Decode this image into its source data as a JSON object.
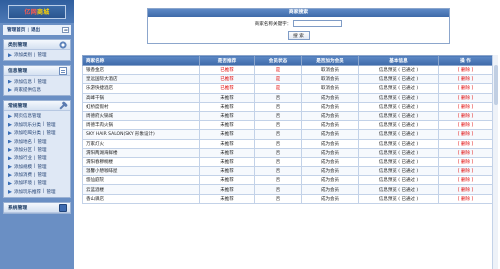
{
  "sidebar": {
    "logo_main": "亿网",
    "logo_accent": "商城",
    "top_links": {
      "home": "管理首页",
      "logout": "退出",
      "toggle": "◂◂"
    },
    "groups": [
      {
        "title": "类别管理",
        "icon": "gear-icon",
        "items": [
          {
            "primary": "添加类别",
            "secondary": "管理"
          }
        ]
      },
      {
        "title": "信息管理",
        "icon": "document-icon",
        "items": [
          {
            "primary": "添加信息",
            "secondary": "管理"
          },
          {
            "primary": "商家提供信息",
            "secondary": ""
          }
        ]
      },
      {
        "title": "常规管理",
        "icon": "wrench-icon",
        "items": [
          {
            "primary": "网页信息管理",
            "secondary": ""
          },
          {
            "primary": "添加玩乐分类",
            "secondary": "管理"
          },
          {
            "primary": "添加吃喝分类",
            "secondary": "管理"
          },
          {
            "primary": "添加地名",
            "secondary": "管理"
          },
          {
            "primary": "添加分区",
            "secondary": "管理"
          },
          {
            "primary": "添加行业",
            "secondary": "管理"
          },
          {
            "primary": "添加规模",
            "secondary": "管理"
          },
          {
            "primary": "添加消费",
            "secondary": "管理"
          },
          {
            "primary": "添加环境",
            "secondary": "管理"
          },
          {
            "primary": "添加玩乐推荐",
            "secondary": "管理"
          }
        ]
      },
      {
        "title": "系统管理",
        "icon": "monitor-icon",
        "items": []
      }
    ]
  },
  "search": {
    "header": "商家搜索",
    "label": "商家名称关键字：",
    "value": "",
    "button": "搜 索"
  },
  "table": {
    "columns": [
      "商家名称",
      "是否推荐",
      "会员状态",
      "是否加为会员",
      "基本信息",
      "操 作"
    ],
    "rows": [
      {
        "name": "银香金店",
        "recommend": "已推荐",
        "status": "是",
        "member": "取消会员",
        "info": "信息预览 ( 已通过 )",
        "op": "[ 删除 ]"
      },
      {
        "name": "皇远国际大酒店",
        "recommend": "已推荐",
        "status": "是",
        "member": "取消会员",
        "info": "信息预览 ( 已通过 )",
        "op": "[ 删除 ]"
      },
      {
        "name": "乐游快捷酒店",
        "recommend": "已推荐",
        "status": "是",
        "member": "取消会员",
        "info": "信息预览 ( 已通过 )",
        "op": "[ 删除 ]"
      },
      {
        "name": "高峰干锅",
        "recommend": "未推荐",
        "status": "否",
        "member": "成为会员",
        "info": "信息预览 ( 已通过 )",
        "op": "[ 删除 ]"
      },
      {
        "name": "虹桥度假村",
        "recommend": "未推荐",
        "status": "否",
        "member": "成为会员",
        "info": "信息预览 ( 已通过 )",
        "op": "[ 删除 ]"
      },
      {
        "name": "周德府火锅城",
        "recommend": "未推荐",
        "status": "否",
        "member": "成为会员",
        "info": "信息预览 ( 已通过 )",
        "op": "[ 删除 ]"
      },
      {
        "name": "周德丰肉火锅",
        "recommend": "未推荐",
        "status": "否",
        "member": "成为会员",
        "info": "信息预览 ( 已通过 )",
        "op": "[ 删除 ]"
      },
      {
        "name": "SKY HAIR SALON(SKY 形象设计)",
        "recommend": "未推荐",
        "status": "否",
        "member": "成为会员",
        "info": "信息预览 ( 已通过 )",
        "op": "[ 删除 ]"
      },
      {
        "name": "万家灯火",
        "recommend": "未推荐",
        "status": "否",
        "member": "成为会员",
        "info": "信息预览 ( 已通过 )",
        "op": "[ 删除 ]"
      },
      {
        "name": "渭阳两湖海鲜楼",
        "recommend": "未推荐",
        "status": "否",
        "member": "成为会员",
        "info": "信息预览 ( 已通过 )",
        "op": "[ 删除 ]"
      },
      {
        "name": "渭阳春穆桐楼",
        "recommend": "未推荐",
        "status": "否",
        "member": "成为会员",
        "info": "信息预览 ( 已通过 )",
        "op": "[ 删除 ]"
      },
      {
        "name": "温馨小憩咖啡屋",
        "recommend": "未推荐",
        "status": "否",
        "member": "成为会员",
        "info": "信息预览 ( 已通过 )",
        "op": "[ 删除 ]"
      },
      {
        "name": "悠仙庭院",
        "recommend": "未推荐",
        "status": "否",
        "member": "成为会员",
        "info": "信息预览 ( 已通过 )",
        "op": "[ 删除 ]"
      },
      {
        "name": "云蓝酒楼",
        "recommend": "未推荐",
        "status": "否",
        "member": "成为会员",
        "info": "信息预览 ( 已通过 )",
        "op": "[ 删除 ]"
      },
      {
        "name": "香山驿店",
        "recommend": "未推荐",
        "status": "否",
        "member": "成为会员",
        "info": "信息预览 ( 已通过 )",
        "op": "[ 删除 ]"
      }
    ]
  },
  "colors": {
    "sidebar_bg": "#6a8fc4",
    "header_blue": "#4a76b4",
    "highlight_red": "#e00000"
  }
}
